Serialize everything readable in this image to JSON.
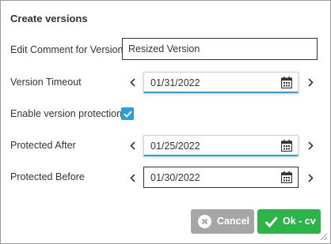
{
  "dialog": {
    "title": "Create versions",
    "comment": {
      "label": "Edit Comment for Version",
      "value": "Resized Version"
    },
    "timeout": {
      "label": "Version Timeout",
      "value": "01/31/2022"
    },
    "protection": {
      "label": "Enable version protection",
      "checked": true
    },
    "protected_after": {
      "label": "Protected After",
      "value": "01/25/2022"
    },
    "protected_before": {
      "label": "Protected Before",
      "value": "01/30/2022"
    },
    "cancel_label": "Cancel",
    "ok_label": "Ok - cv"
  },
  "colors": {
    "accent": "#2a9fd6",
    "ok_button": "#2cb34a",
    "cancel_button": "#a6a6a6"
  },
  "icons": [
    "chevron-left-icon",
    "chevron-right-icon",
    "calendar-icon",
    "checkmark-icon",
    "cancel-x-icon",
    "resize-grip-icon"
  ]
}
